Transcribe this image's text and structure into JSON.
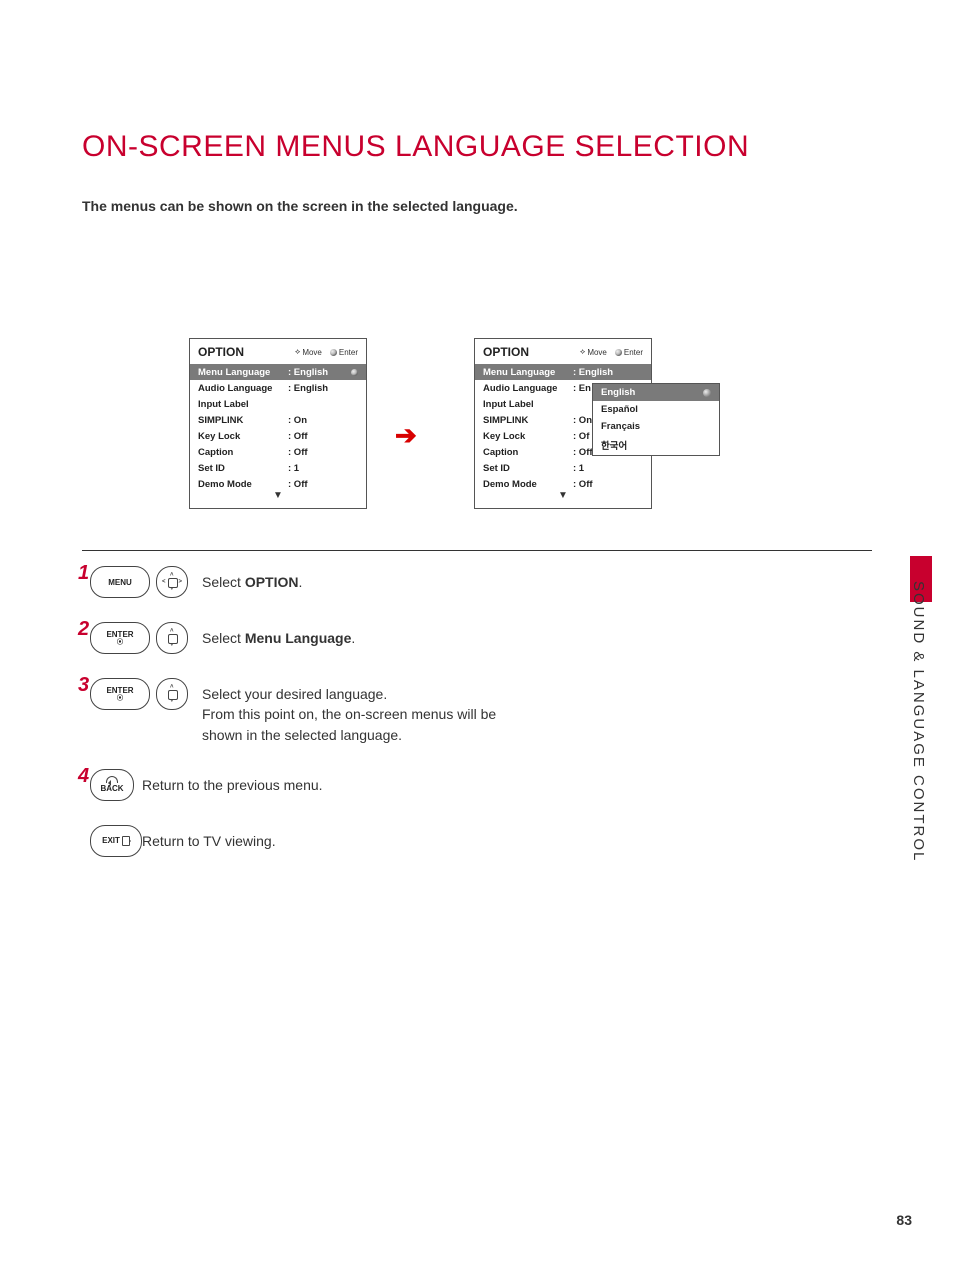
{
  "title": "ON-SCREEN MENUS LANGUAGE SELECTION",
  "intro": "The menus can be shown on the screen in the selected language.",
  "osd": {
    "header": "OPTION",
    "hint_move": "Move",
    "hint_enter": "Enter",
    "rows": [
      {
        "label": "Menu Language",
        "value": ": English"
      },
      {
        "label": "Audio Language",
        "value": ": English"
      },
      {
        "label": "Input Label",
        "value": ""
      },
      {
        "label": "SIMPLINK",
        "value": ": On"
      },
      {
        "label": "Key Lock",
        "value": ": Off"
      },
      {
        "label": "Caption",
        "value": ": Off"
      },
      {
        "label": "Set ID",
        "value": ": 1"
      },
      {
        "label": "Demo Mode",
        "value": ": Off"
      }
    ],
    "right_audio_short": ": En",
    "right_simplink_short": ": On",
    "right_keylock_short": ": Of",
    "dropdown": [
      "English",
      "Español",
      "Français",
      "한국어"
    ]
  },
  "steps": {
    "s1": {
      "btn": "MENU",
      "text_prefix": "Select ",
      "text_bold": "OPTION",
      "text_suffix": "."
    },
    "s2": {
      "btn": "ENTER",
      "text_prefix": "Select ",
      "text_bold": "Menu Language",
      "text_suffix": "."
    },
    "s3": {
      "btn": "ENTER",
      "line1": "Select your desired language.",
      "line2": "From this point on, the on-screen menus will be shown in the selected language."
    },
    "s4": {
      "btn": "BACK",
      "text": "Return to the previous menu."
    },
    "s5": {
      "btn": "EXIT",
      "text": "Return to TV viewing."
    }
  },
  "side_tab": "SOUND & LANGUAGE CONTROL",
  "page_number": "83"
}
